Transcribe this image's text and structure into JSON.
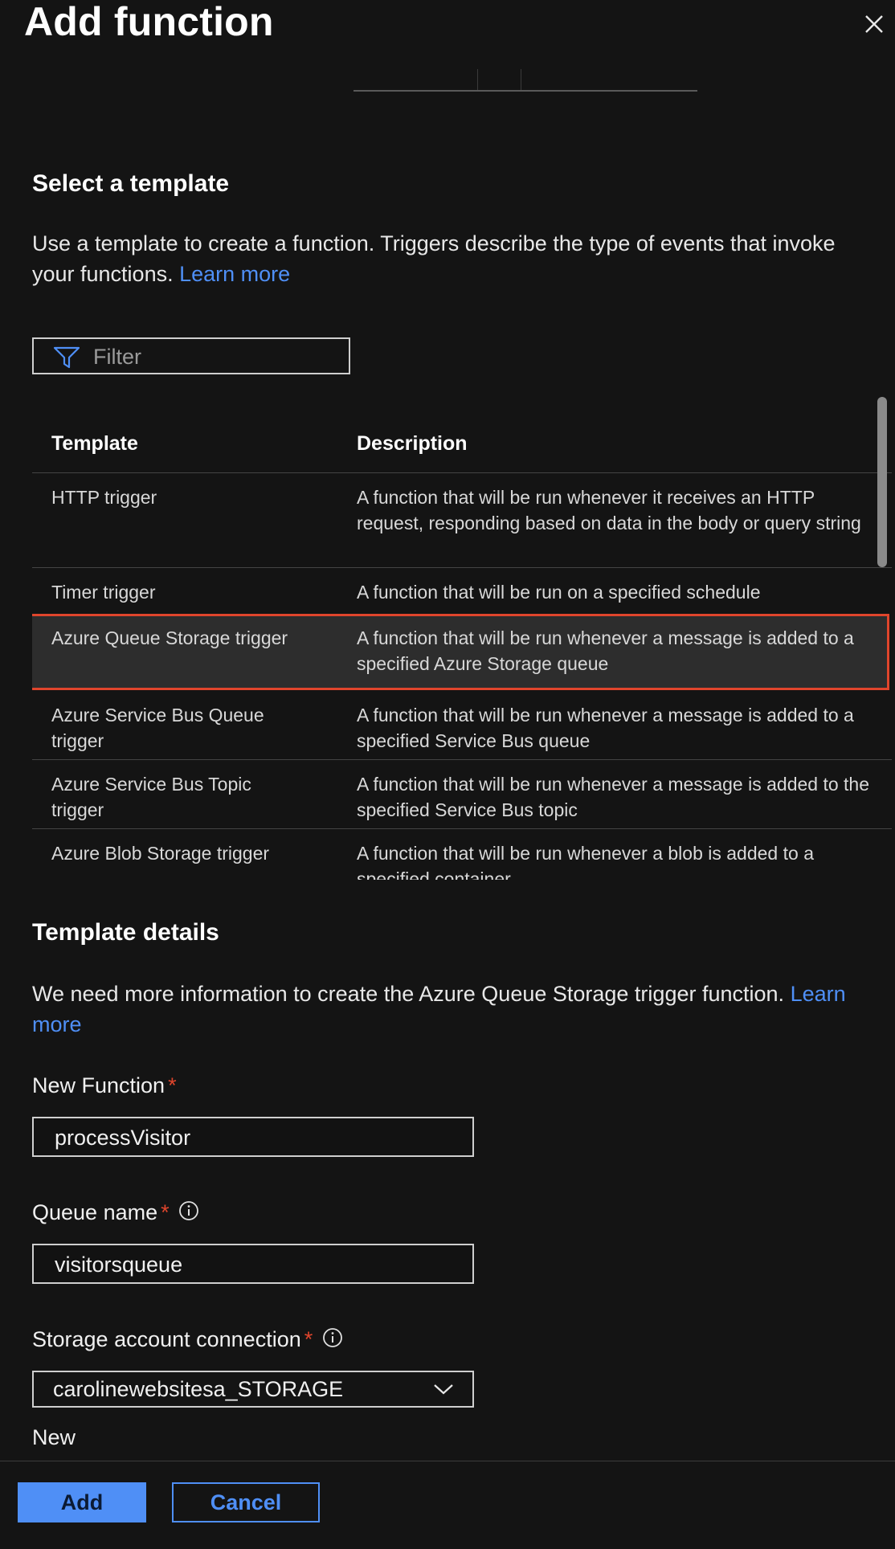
{
  "header": {
    "title": "Add function"
  },
  "template_section": {
    "heading": "Select a template",
    "description": "Use a template to create a function. Triggers describe the type of events that invoke your functions.",
    "learn_more": "Learn more",
    "filter_placeholder": "Filter"
  },
  "table": {
    "columns": [
      "Template",
      "Description"
    ],
    "rows": [
      {
        "name": "HTTP trigger",
        "description": "A function that will be run whenever it receives an HTTP request, responding based on data in the body or query string",
        "selected": false
      },
      {
        "name": "Timer trigger",
        "description": "A function that will be run on a specified schedule",
        "selected": false
      },
      {
        "name": "Azure Queue Storage trigger",
        "description": "A function that will be run whenever a message is added to a specified Azure Storage queue",
        "selected": true
      },
      {
        "name": "Azure Service Bus Queue trigger",
        "description": "A function that will be run whenever a message is added to a specified Service Bus queue",
        "selected": false
      },
      {
        "name": "Azure Service Bus Topic trigger",
        "description": "A function that will be run whenever a message is added to the specified Service Bus topic",
        "selected": false
      },
      {
        "name": "Azure Blob Storage trigger",
        "description": "A function that will be run whenever a blob is added to a specified container",
        "selected": false
      }
    ]
  },
  "details_section": {
    "heading": "Template details",
    "description": "We need more information to create the Azure Queue Storage trigger function.",
    "learn_more": "Learn more"
  },
  "form": {
    "new_function_label": "New Function",
    "new_function_value": "processVisitor",
    "queue_name_label": "Queue name",
    "queue_name_value": "visitorsqueue",
    "storage_label": "Storage account connection",
    "storage_value": "carolinewebsitesa_STORAGE",
    "new_link": "New",
    "required_mark": "*"
  },
  "footer": {
    "add_label": "Add",
    "cancel_label": "Cancel"
  },
  "colors": {
    "accent": "#4f8ff6",
    "selection_outline": "#e0452c",
    "background": "#141414"
  }
}
